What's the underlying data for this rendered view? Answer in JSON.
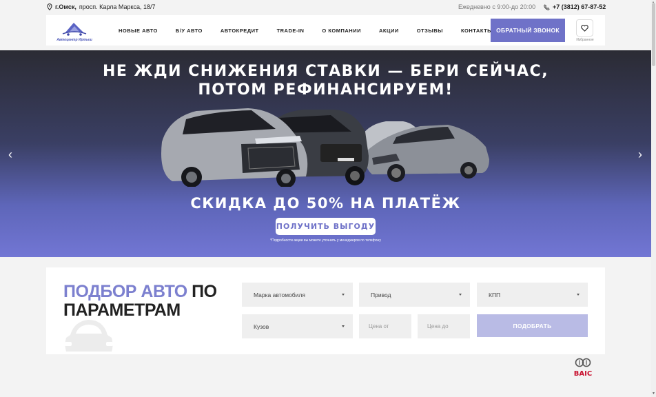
{
  "topbar": {
    "city": "г.Омск,",
    "address": "просп. Карла Маркса, 18/7",
    "hours": "Ежедневно с 9:00-до 20:00",
    "phone": "+7 (3812) 67-87-52"
  },
  "header": {
    "logo_text": "Автоцентр Иртыш",
    "nav": [
      {
        "label": "НОВЫЕ АВТО"
      },
      {
        "label": "Б/У АВТО"
      },
      {
        "label": "АВТОКРЕДИТ"
      },
      {
        "label": "TRADE-IN"
      },
      {
        "label": "О КОМПАНИИ"
      },
      {
        "label": "АКЦИИ"
      },
      {
        "label": "ОТЗЫВЫ"
      },
      {
        "label": "КОНТАКТЫ"
      }
    ],
    "callback_label": "ОБРАТНЫЙ ЗВОНОК",
    "favorites_label": "Избранное"
  },
  "hero": {
    "title_line1": "НЕ ЖДИ СНИЖЕНИЯ СТАВКИ — БЕРИ СЕЙЧАС,",
    "title_line2": "ПОТОМ РЕФИНАНСИРУЕМ!",
    "subtitle": "СКИДКА ДО 50% НА ПЛАТЁЖ",
    "button_label": "ПОЛУЧИТЬ ВЫГОДУ",
    "note": "*Подробности акции вы можете уточнить у менеджеров по телефону",
    "prev_icon": "‹",
    "next_icon": "›"
  },
  "filter": {
    "title_accent": "ПОДБОР АВТО",
    "title_rest1": " ПО",
    "title_line2": "ПАРАМЕТРАМ",
    "brand_select": "Марка автомобиля",
    "drive_select": "Привод",
    "gearbox_select": "КПП",
    "body_select": "Кузов",
    "price_from_placeholder": "Цена от",
    "price_to_placeholder": "Цена до",
    "submit_label": "ПОДОБРАТЬ"
  },
  "brand_logo": {
    "name": "BAIC"
  },
  "colors": {
    "accent": "#6f72c8",
    "accent_light": "#7c80cf",
    "submit_disabled": "#b9bbe5",
    "brand_red": "#c8102e"
  }
}
